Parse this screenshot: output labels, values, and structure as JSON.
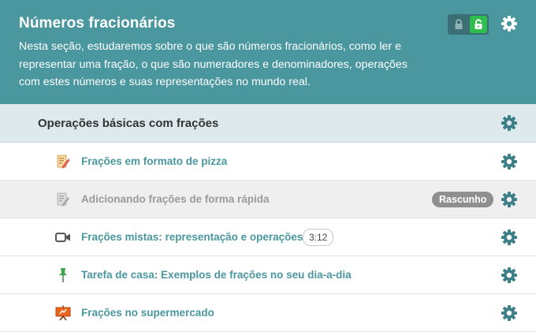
{
  "header": {
    "title": "Números fracionários",
    "description": "Nesta seção, estudaremos sobre o que são números fracionários, como ler e representar uma fração, o que são numeradores e denominadores, operações com estes números e suas representações no mundo real.",
    "lock_icons": [
      "lock-closed-icon",
      "lock-open-icon"
    ],
    "background_color": "#4a979f"
  },
  "section": {
    "title": "Operações básicas com frações",
    "background_color": "#dde9ec"
  },
  "items": [
    {
      "label": "Frações em formato de pizza",
      "icon": "page-pencil-icon",
      "status": "",
      "duration": ""
    },
    {
      "label": "Adicionando frações de forma rápida",
      "icon": "page-pencil-icon",
      "status": "Rascunho",
      "duration": ""
    },
    {
      "label": "Frações mistas: representação e operações",
      "icon": "video-camera-icon",
      "status": "",
      "duration": "3:12"
    },
    {
      "label": "Tarefa de casa: Exemplos de frações no seu dia-a-dia",
      "icon": "pushpin-icon",
      "status": "",
      "duration": ""
    },
    {
      "label": "Frações no supermercado",
      "icon": "presentation-icon",
      "status": "",
      "duration": ""
    }
  ],
  "colors": {
    "accent": "#4a979f",
    "unlocked": "#2ebd4e",
    "draft_badge": "#8f8f8f",
    "gear": "#3d7f87"
  }
}
